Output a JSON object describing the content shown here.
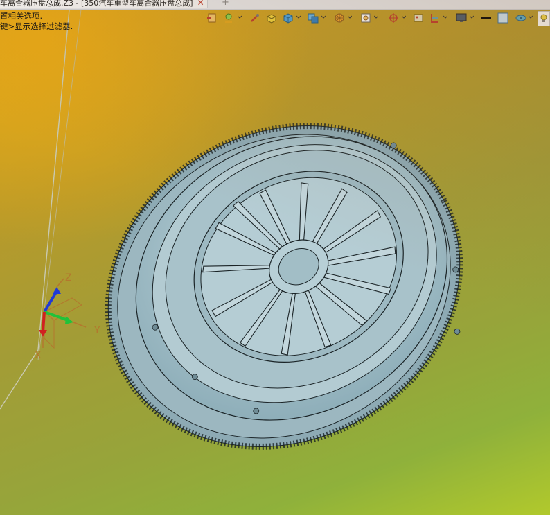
{
  "window": {
    "doc_tab_title": "车离合器压盘总成.Z3 - [350汽车重型车离合器压盘总成]",
    "tab_close_glyph": "✕",
    "new_tab_glyph": "+"
  },
  "hints": {
    "line1": "置相关选项.",
    "line2": "键>显示选择过滤器."
  },
  "toolbar": {
    "icons": [
      "open-file-icon",
      "layer-palette-icon",
      "brush-icon",
      "solid-yellow-icon",
      "cube-icon",
      "multi-cube-icon",
      "wheel-icon",
      "view-frame-icon",
      "target-icon",
      "image-icon",
      "section-icon",
      "monitor-icon",
      "black-rect-icon",
      "blue-square-icon",
      "eye-icon",
      "lamp-icon"
    ]
  },
  "axes": {
    "z_label": "Z",
    "y_label": "Y",
    "x_label": "X"
  },
  "colors": {
    "model": "#a9c3cc",
    "edges": "#1a2326",
    "axis_z": "#1f3ad6",
    "axis_y": "#20c23a",
    "axis_x": "#d12020",
    "axis_label": "#b3782e"
  }
}
